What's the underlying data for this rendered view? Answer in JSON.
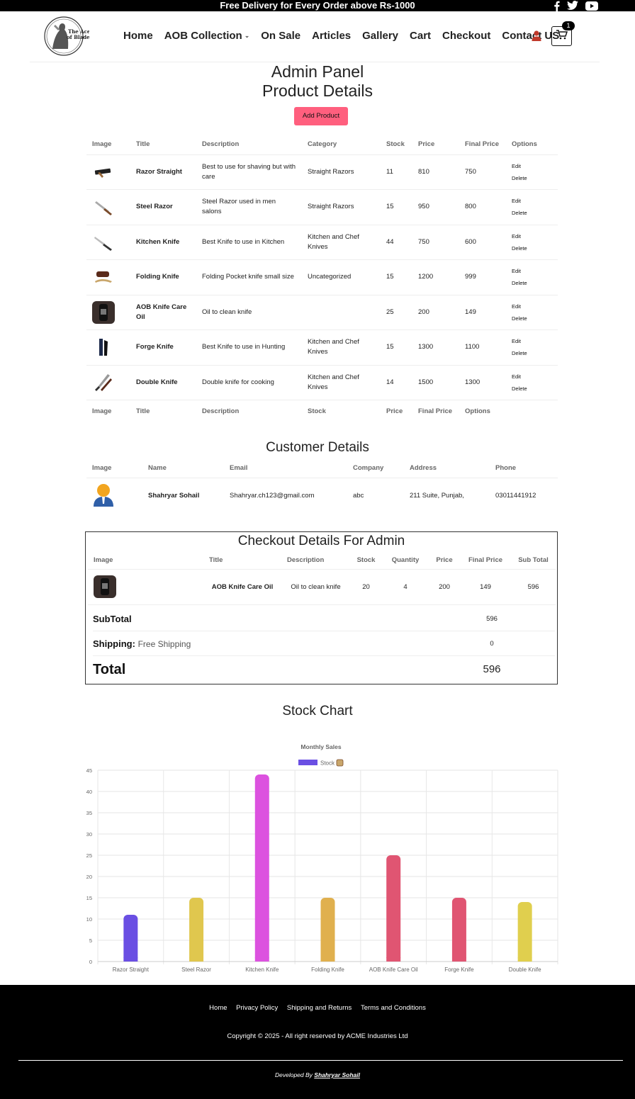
{
  "topbar": {
    "message": "Free Delivery for Every Order above Rs-1000",
    "social": [
      "facebook-icon",
      "twitter-icon",
      "youtube-icon"
    ]
  },
  "header": {
    "logo_text": "The Ace of Blades",
    "nav": [
      "Home",
      "AOB Collection",
      "On Sale",
      "Articles",
      "Gallery",
      "Cart",
      "Checkout",
      "Contact US"
    ],
    "cart_count": "1"
  },
  "admin": {
    "title": "Admin Panel",
    "subtitle": "Product Details",
    "add_button": "Add Product",
    "columns": [
      "Image",
      "Title",
      "Description",
      "Category",
      "Stock",
      "Price",
      "Final Price",
      "Options"
    ],
    "footer_columns": [
      "Image",
      "Title",
      "Description",
      "Stock",
      "Price",
      "Final Price",
      "Options"
    ],
    "edit_label": "Edit",
    "delete_label": "Delete",
    "products": [
      {
        "title": "Razor Straight",
        "description": "Best to use for shaving but with care",
        "category": "Straight Razors",
        "stock": "11",
        "price": "810",
        "final_price": "750",
        "icon": "razor-icon"
      },
      {
        "title": "Steel Razor",
        "description": "Steel Razor used in men salons",
        "category": "Straight Razors",
        "stock": "15",
        "price": "950",
        "final_price": "800",
        "icon": "razor-icon"
      },
      {
        "title": "Kitchen Knife",
        "description": "Best Knife to use in Kitchen",
        "category": "Kitchen and Chef Knives",
        "stock": "44",
        "price": "750",
        "final_price": "600",
        "icon": "knife-icon"
      },
      {
        "title": "Folding Knife",
        "description": "Folding Pocket knife small size",
        "category": "Uncategorized",
        "stock": "15",
        "price": "1200",
        "final_price": "999",
        "icon": "folding-knife-icon"
      },
      {
        "title": "AOB Knife Care Oil",
        "description": "Oil to clean knife",
        "category": "",
        "stock": "25",
        "price": "200",
        "final_price": "149",
        "icon": "oil-bottle-icon"
      },
      {
        "title": "Forge Knife",
        "description": "Best Knife to use in Hunting",
        "category": "Kitchen and Chef Knives",
        "stock": "15",
        "price": "1300",
        "final_price": "1100",
        "icon": "knife-icon"
      },
      {
        "title": "Double Knife",
        "description": "Double knife for cooking",
        "category": "Kitchen and Chef Knives",
        "stock": "14",
        "price": "1500",
        "final_price": "1300",
        "icon": "knife-icon"
      }
    ]
  },
  "customers": {
    "title": "Customer Details",
    "columns": [
      "Image",
      "Name",
      "Email",
      "Company",
      "Address",
      "Phone"
    ],
    "rows": [
      {
        "name": "Shahryar Sohail",
        "email": "Shahryar.ch123@gmail.com",
        "company": "abc",
        "address": "211 Suite, Punjab,",
        "phone": "03011441912"
      }
    ]
  },
  "checkout": {
    "title": "Checkout Details For Admin",
    "columns": [
      "Image",
      "Title",
      "Description",
      "Stock",
      "Quantity",
      "Price",
      "Final Price",
      "Sub Total"
    ],
    "rows": [
      {
        "title": "AOB Knife Care Oil",
        "description": "Oil to clean knife",
        "stock": "20",
        "quantity": "4",
        "price": "200",
        "final_price": "149",
        "sub_total": "596"
      }
    ],
    "subtotal_label": "SubTotal",
    "subtotal_value": "596",
    "shipping_label": "Shipping:",
    "shipping_method": "Free Shipping",
    "shipping_value": "0",
    "total_label": "Total",
    "total_value": "596"
  },
  "stock_chart": {
    "heading": "Stock Chart"
  },
  "chart_data": {
    "type": "bar",
    "title": "Monthly Sales",
    "categories": [
      "Razor Straight",
      "Steel Razor",
      "Kitchen Knife",
      "Folding Knife",
      "AOB Knife Care Oil",
      "Forge Knife",
      "Double Knife"
    ],
    "series": [
      {
        "name": "Stock",
        "values": [
          11,
          15,
          44,
          15,
          25,
          15,
          14
        ]
      }
    ],
    "colors": [
      "#6a4fe3",
      "#e0c74e",
      "#dc52df",
      "#e0b04e",
      "#e05572",
      "#e05572",
      "#e0cf4e"
    ],
    "ylim": [
      0,
      45
    ],
    "yticks": [
      0,
      5,
      10,
      15,
      20,
      25,
      30,
      35,
      40,
      45
    ],
    "grid": true,
    "legend": "top-center"
  },
  "footer": {
    "links": [
      "Home",
      "Privacy Policy",
      "Shipping and Returns",
      "Terms and Conditions"
    ],
    "copyright": "Copyright © 2025 - All right reserved by ACME Industries Ltd",
    "developed_by": "Developed By",
    "developer": "Shahryar Sohail"
  }
}
